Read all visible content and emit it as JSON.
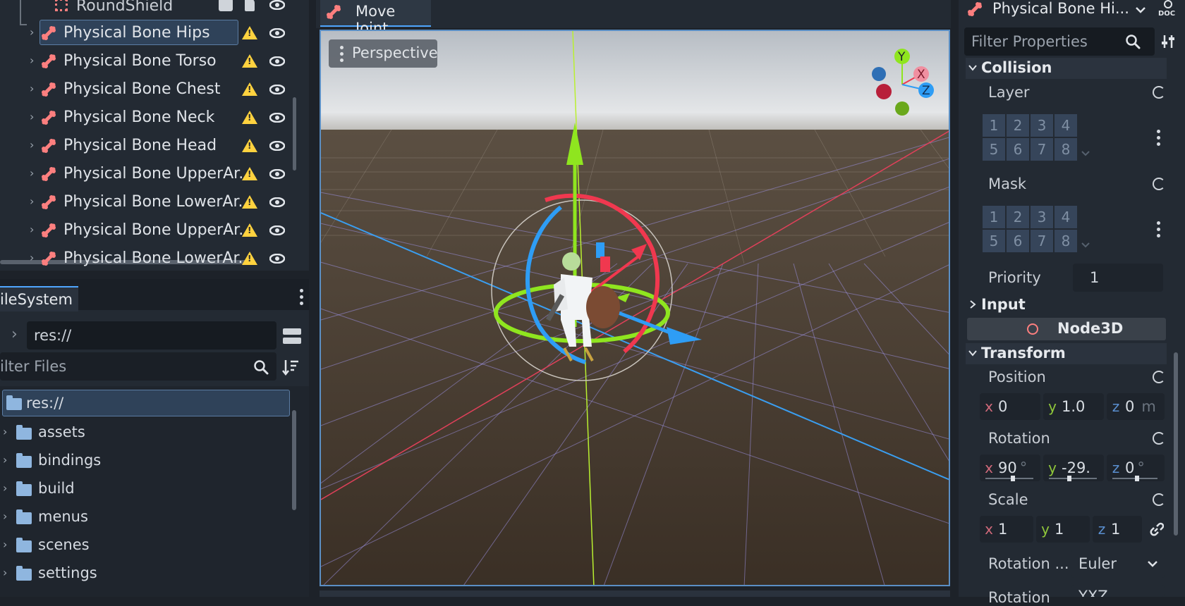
{
  "scene_tree": {
    "rows": [
      {
        "label": "RoundShield",
        "selected": false
      },
      {
        "label": "Physical Bone Hips",
        "selected": true
      },
      {
        "label": "Physical Bone Torso",
        "selected": false
      },
      {
        "label": "Physical Bone Chest",
        "selected": false
      },
      {
        "label": "Physical Bone Neck",
        "selected": false
      },
      {
        "label": "Physical Bone Head",
        "selected": false
      },
      {
        "label": "Physical Bone UpperAr...",
        "selected": false
      },
      {
        "label": "Physical Bone LowerAr...",
        "selected": false
      },
      {
        "label": "Physical Bone UpperAr...",
        "selected": false
      },
      {
        "label": "Physical Bone LowerAr...",
        "selected": false
      }
    ]
  },
  "filesystem": {
    "tab_label": "ileSystem",
    "path_value": "res://",
    "filter_placeholder": "ilter Files",
    "root": "res://",
    "folders": [
      "assets",
      "bindings",
      "build",
      "menus",
      "scenes",
      "settings"
    ]
  },
  "viewport": {
    "toolbar_button": "Move Joint",
    "perspective_label": "Perspective",
    "gizmo_labels": {
      "y": "Y",
      "x": "X",
      "z": "Z"
    }
  },
  "inspector": {
    "node_name": "Physical Bone Hi...",
    "doc_label": "DOC",
    "filter_placeholder": "Filter Properties",
    "collision_section": "Collision",
    "layer_label": "Layer",
    "layer_bits": [
      "1",
      "2",
      "3",
      "4",
      "5",
      "6",
      "7",
      "8"
    ],
    "mask_label": "Mask",
    "mask_bits": [
      "1",
      "2",
      "3",
      "4",
      "5",
      "6",
      "7",
      "8"
    ],
    "priority_label": "Priority",
    "priority_value": "1",
    "input_section": "Input",
    "node3d_label": "Node3D",
    "transform_section": "Transform",
    "position_label": "Position",
    "position": {
      "x": "0",
      "y": "1.0",
      "z": "0",
      "unit": "m"
    },
    "rotation_label": "Rotation",
    "rotation": {
      "x": "90",
      "y": "-29.",
      "z": "0",
      "unit": "°"
    },
    "scale_label": "Scale",
    "scale": {
      "x": "1",
      "y": "1",
      "z": "1"
    },
    "rotation_mode_label": "Rotation ...",
    "rotation_mode_value": "Euler",
    "rotation_order_label": "Rotation",
    "rotation_order_value": "YXZ"
  },
  "colors": {
    "accent": "#4fa6ff",
    "x_axis": "#f0384f",
    "y_axis": "#8fe51f",
    "z_axis": "#2e9df5",
    "warning": "#ffd23f",
    "bone": "#fc7f7f"
  }
}
